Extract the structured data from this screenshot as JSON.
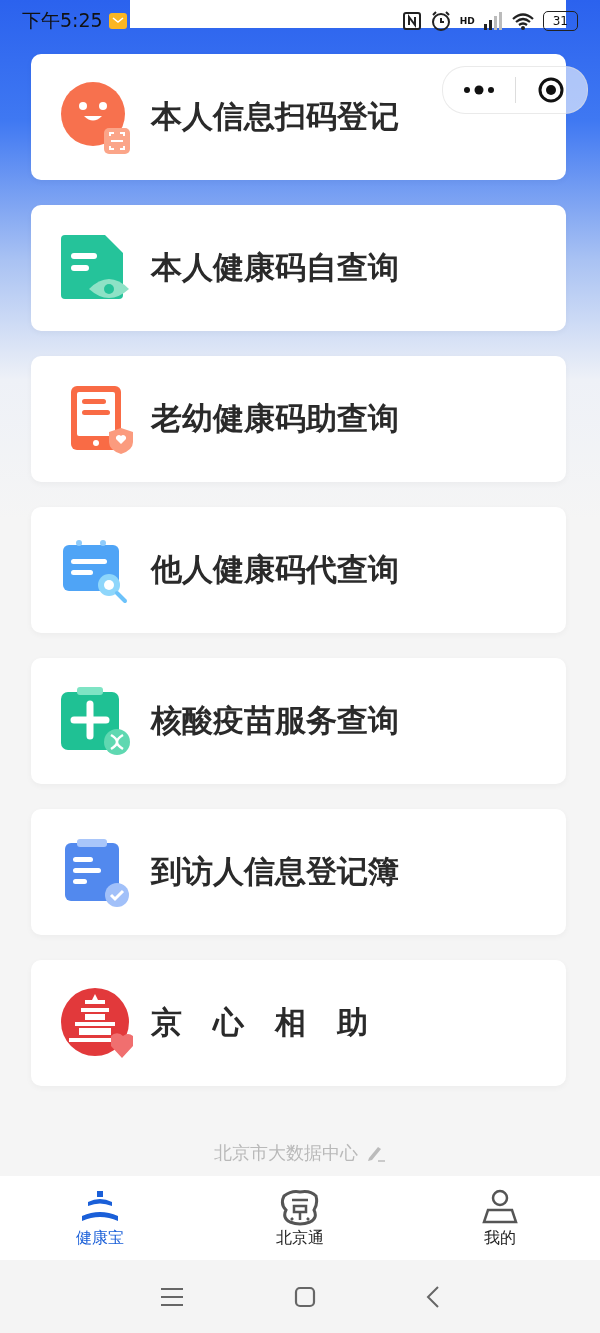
{
  "status_bar": {
    "time": "下午5:25",
    "network": "HD",
    "battery": "31"
  },
  "menu": [
    {
      "label": "本人信息扫码登记",
      "kind": "face"
    },
    {
      "label": "本人健康码自查询",
      "kind": "document"
    },
    {
      "label": "老幼健康码助查询",
      "kind": "tablet"
    },
    {
      "label": "他人健康码代查询",
      "kind": "calendar"
    },
    {
      "label": "核酸疫苗服务查询",
      "kind": "medical"
    },
    {
      "label": "到访人信息登记簿",
      "kind": "clipboard"
    },
    {
      "label": "京　心　相　助",
      "kind": "temple"
    }
  ],
  "footer": "北京市大数据中心",
  "tabs": [
    {
      "label": "健康宝",
      "kind": "temple",
      "selected": true
    },
    {
      "label": "北京通",
      "kind": "logo",
      "selected": false
    },
    {
      "label": "我的",
      "kind": "person",
      "selected": false
    }
  ]
}
